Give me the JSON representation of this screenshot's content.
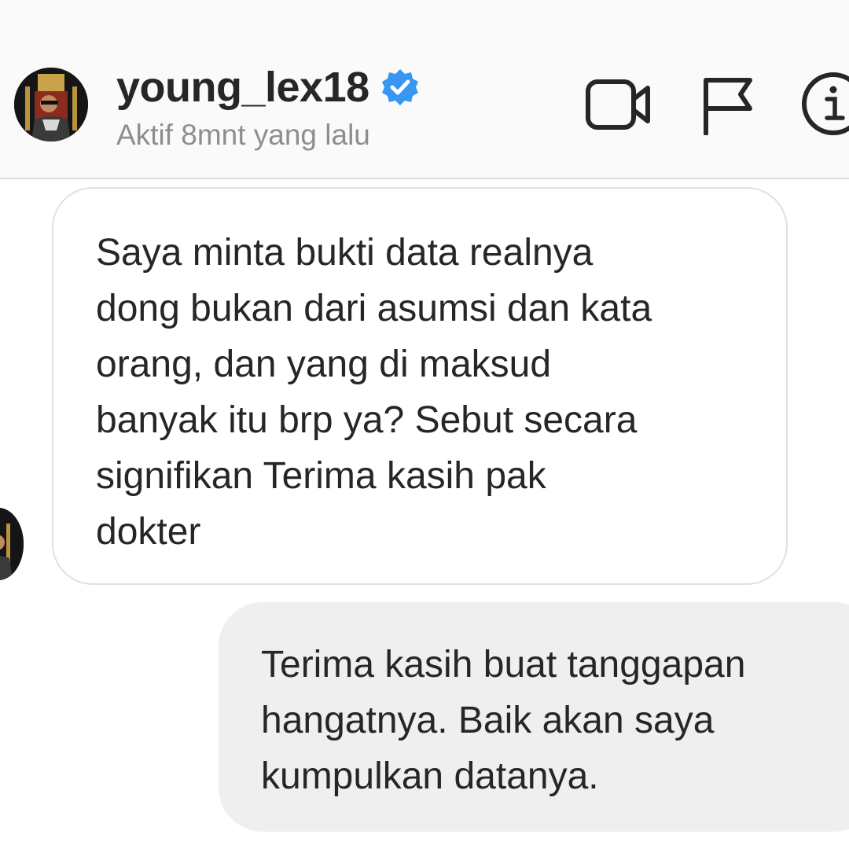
{
  "header": {
    "username": "young_lex18",
    "status": "Aktif 8mnt yang lalu",
    "verified_color": "#3897f0",
    "icons": [
      "video-call-icon",
      "flag-icon",
      "info-icon"
    ]
  },
  "messages": [
    {
      "direction": "incoming",
      "text": "Saya minta bukti data realnya\ndong bukan dari asumsi dan kata\norang, dan yang di maksud\nbanyak itu brp ya? Sebut secara\nsignifikan Terima kasih pak\ndokter"
    },
    {
      "direction": "outgoing",
      "text": "Terima kasih buat tanggapan\nhangatnya. Baik akan saya\nkumpulkan datanya."
    }
  ],
  "colors": {
    "header_bg": "#fafafa",
    "incoming_bubble_border": "#e0e0e0",
    "outgoing_bubble_bg": "#efefef",
    "text": "#262626",
    "secondary_text": "#8e8e8e"
  }
}
